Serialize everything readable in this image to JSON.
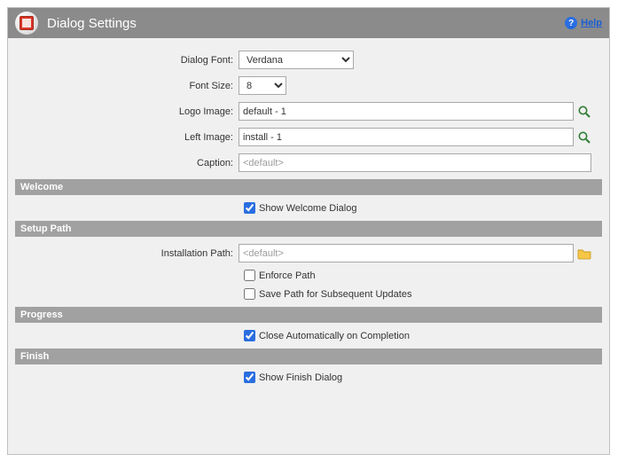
{
  "title": "Dialog Settings",
  "help": "Help",
  "fields": {
    "dialogFontLabel": "Dialog Font:",
    "dialogFontValue": "Verdana",
    "fontSizeLabel": "Font Size:",
    "fontSizeValue": "8",
    "logoImageLabel": "Logo Image:",
    "logoImageValue": "default - 1",
    "leftImageLabel": "Left Image:",
    "leftImageValue": "install - 1",
    "captionLabel": "Caption:",
    "captionPlaceholder": "<default>"
  },
  "sections": {
    "welcome": "Welcome",
    "setupPath": "Setup Path",
    "progress": "Progress",
    "finish": "Finish"
  },
  "welcome": {
    "showWelcome": "Show Welcome Dialog",
    "showWelcomeChecked": true
  },
  "setupPath": {
    "installationPathLabel": "Installation Path:",
    "installationPathPlaceholder": "<default>",
    "enforcePath": "Enforce Path",
    "enforcePathChecked": false,
    "savePath": "Save Path for Subsequent Updates",
    "savePathChecked": false
  },
  "progress": {
    "closeAuto": "Close Automatically on Completion",
    "closeAutoChecked": true
  },
  "finish": {
    "showFinish": "Show Finish Dialog",
    "showFinishChecked": true
  }
}
